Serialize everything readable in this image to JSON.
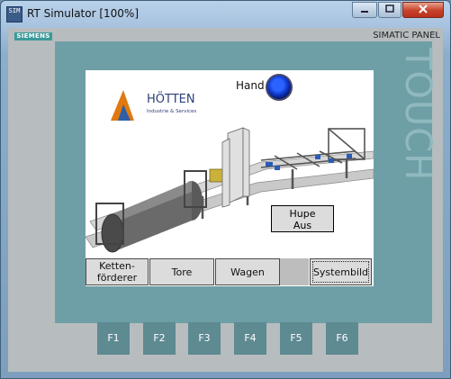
{
  "window": {
    "title": "RT Simulator [100%]",
    "icon_text": "SIM"
  },
  "panel": {
    "brand": "SIEMENS",
    "model": "SIMATIC PANEL",
    "bezel_text": "TOUCH"
  },
  "screen": {
    "hand_label": "Hand",
    "logo": {
      "name": "HÖTTEN",
      "tagline": "Industrie & Services"
    },
    "hupe_button": {
      "line1": "Hupe",
      "line2": "Aus"
    },
    "nav": {
      "ketten_line1": "Ketten-",
      "ketten_line2": "förderer",
      "tore": "Tore",
      "wagen": "Wagen",
      "systembild": "Systembild"
    }
  },
  "function_keys": [
    "F1",
    "F2",
    "F3",
    "F4",
    "F5",
    "F6"
  ],
  "colors": {
    "indicator": "#1a4cf0",
    "bezel": "#6f9fa6",
    "siemens": "#3b9a9a"
  }
}
